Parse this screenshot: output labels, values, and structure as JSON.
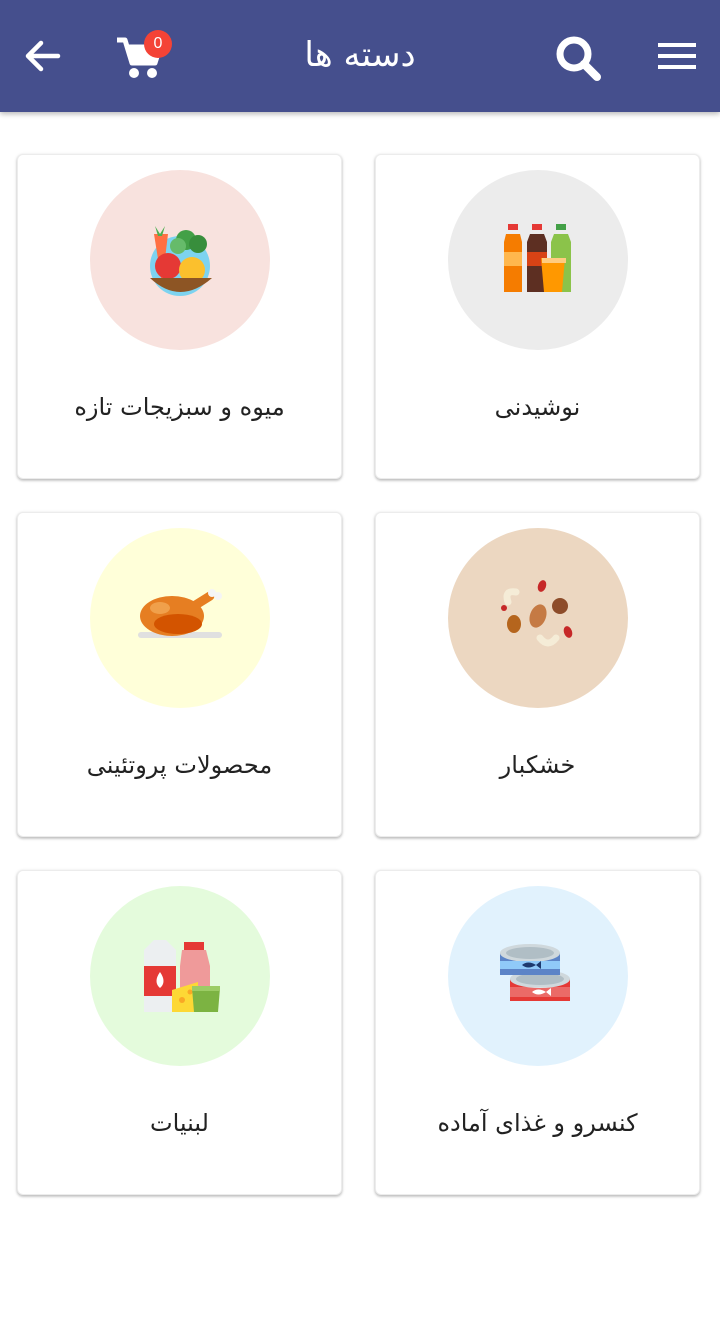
{
  "header": {
    "title": "دسته ها",
    "cart_count": "0",
    "background": "#454f8d"
  },
  "categories": [
    {
      "label": "نوشیدنی",
      "icon": "beverages-icon",
      "circle_color": "#ececec"
    },
    {
      "label": "میوه و سبزیجات تازه",
      "icon": "fruits-vegetables-icon",
      "circle_color": "#f8e2de"
    },
    {
      "label": "خشکبار",
      "icon": "nuts-icon",
      "circle_color": "#ecd7c1"
    },
    {
      "label": "محصولات پروتئینی",
      "icon": "roast-chicken-icon",
      "circle_color": "#ffffd9"
    },
    {
      "label": "کنسرو و غذای آماده",
      "icon": "canned-food-icon",
      "circle_color": "#e1f2fd"
    },
    {
      "label": "لبنیات",
      "icon": "dairy-icon",
      "circle_color": "#e4fbdc"
    }
  ]
}
